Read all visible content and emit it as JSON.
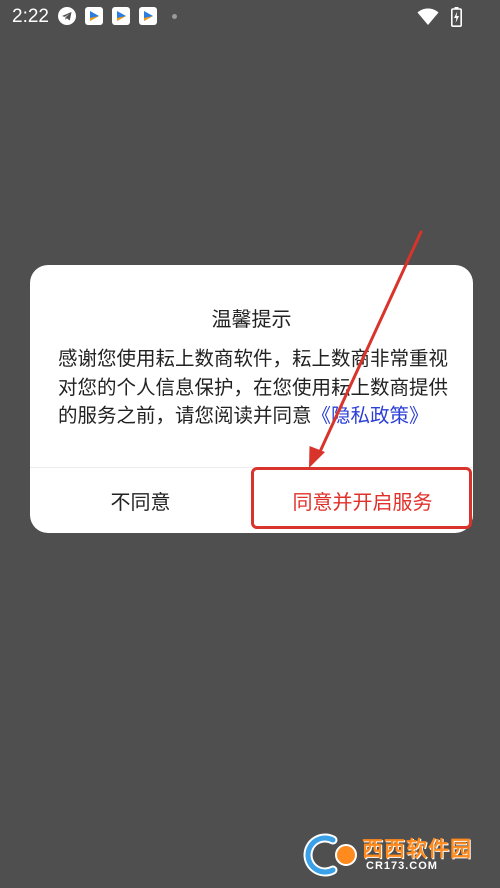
{
  "status_bar": {
    "time": "2:22",
    "app_icons": [
      "telegram-icon",
      "app-icon",
      "app-icon",
      "app-icon"
    ],
    "right_icons": [
      "wifi-icon",
      "battery-charging-icon"
    ]
  },
  "dialog": {
    "title": "温馨提示",
    "body_prefix": "感谢您使用耘上数商软件，耘上数商非常重视对您的个人信息保护，在您使用耘上数商提供的服务之前，请您阅读并同意",
    "policy_link": "《隐私政策》",
    "decline_label": "不同意",
    "accept_label": "同意并开启服务"
  },
  "colors": {
    "backdrop": "#4f4f4f",
    "accept": "#e0302a",
    "link": "#2b3fd6",
    "annotation": "#d9342b",
    "watermark": "#ff8a1e"
  },
  "watermark": {
    "text": "西西软件园",
    "sub": "CR173.COM"
  }
}
